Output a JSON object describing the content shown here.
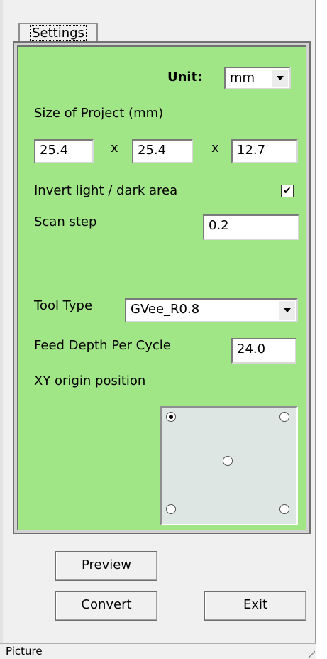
{
  "tab": {
    "label": "Settings"
  },
  "unit": {
    "label": "Unit:",
    "value": "mm"
  },
  "project_size": {
    "label": "Size of Project (mm)",
    "x": "25.4",
    "y": "25.4",
    "z": "12.7",
    "separator": "x"
  },
  "invert": {
    "label": "Invert light / dark area",
    "checked": true,
    "mark": "✔"
  },
  "scan_step": {
    "label": "Scan step",
    "value": "0.2"
  },
  "tool_type": {
    "label": "Tool Type",
    "value": "GVee_R0.8"
  },
  "feed_depth": {
    "label": "Feed Depth Per Cycle",
    "value": "24.0"
  },
  "xy_origin": {
    "label": "XY origin position",
    "options": [
      "top-left",
      "top-right",
      "center",
      "bottom-left",
      "bottom-right"
    ],
    "selected": "top-left"
  },
  "buttons": {
    "preview": "Preview",
    "convert": "Convert",
    "exit": "Exit"
  },
  "status": {
    "text": "Picture"
  },
  "colors": {
    "panel": "#a0e686",
    "origin_box": "#dde6e3",
    "window": "#f0f0f0"
  }
}
